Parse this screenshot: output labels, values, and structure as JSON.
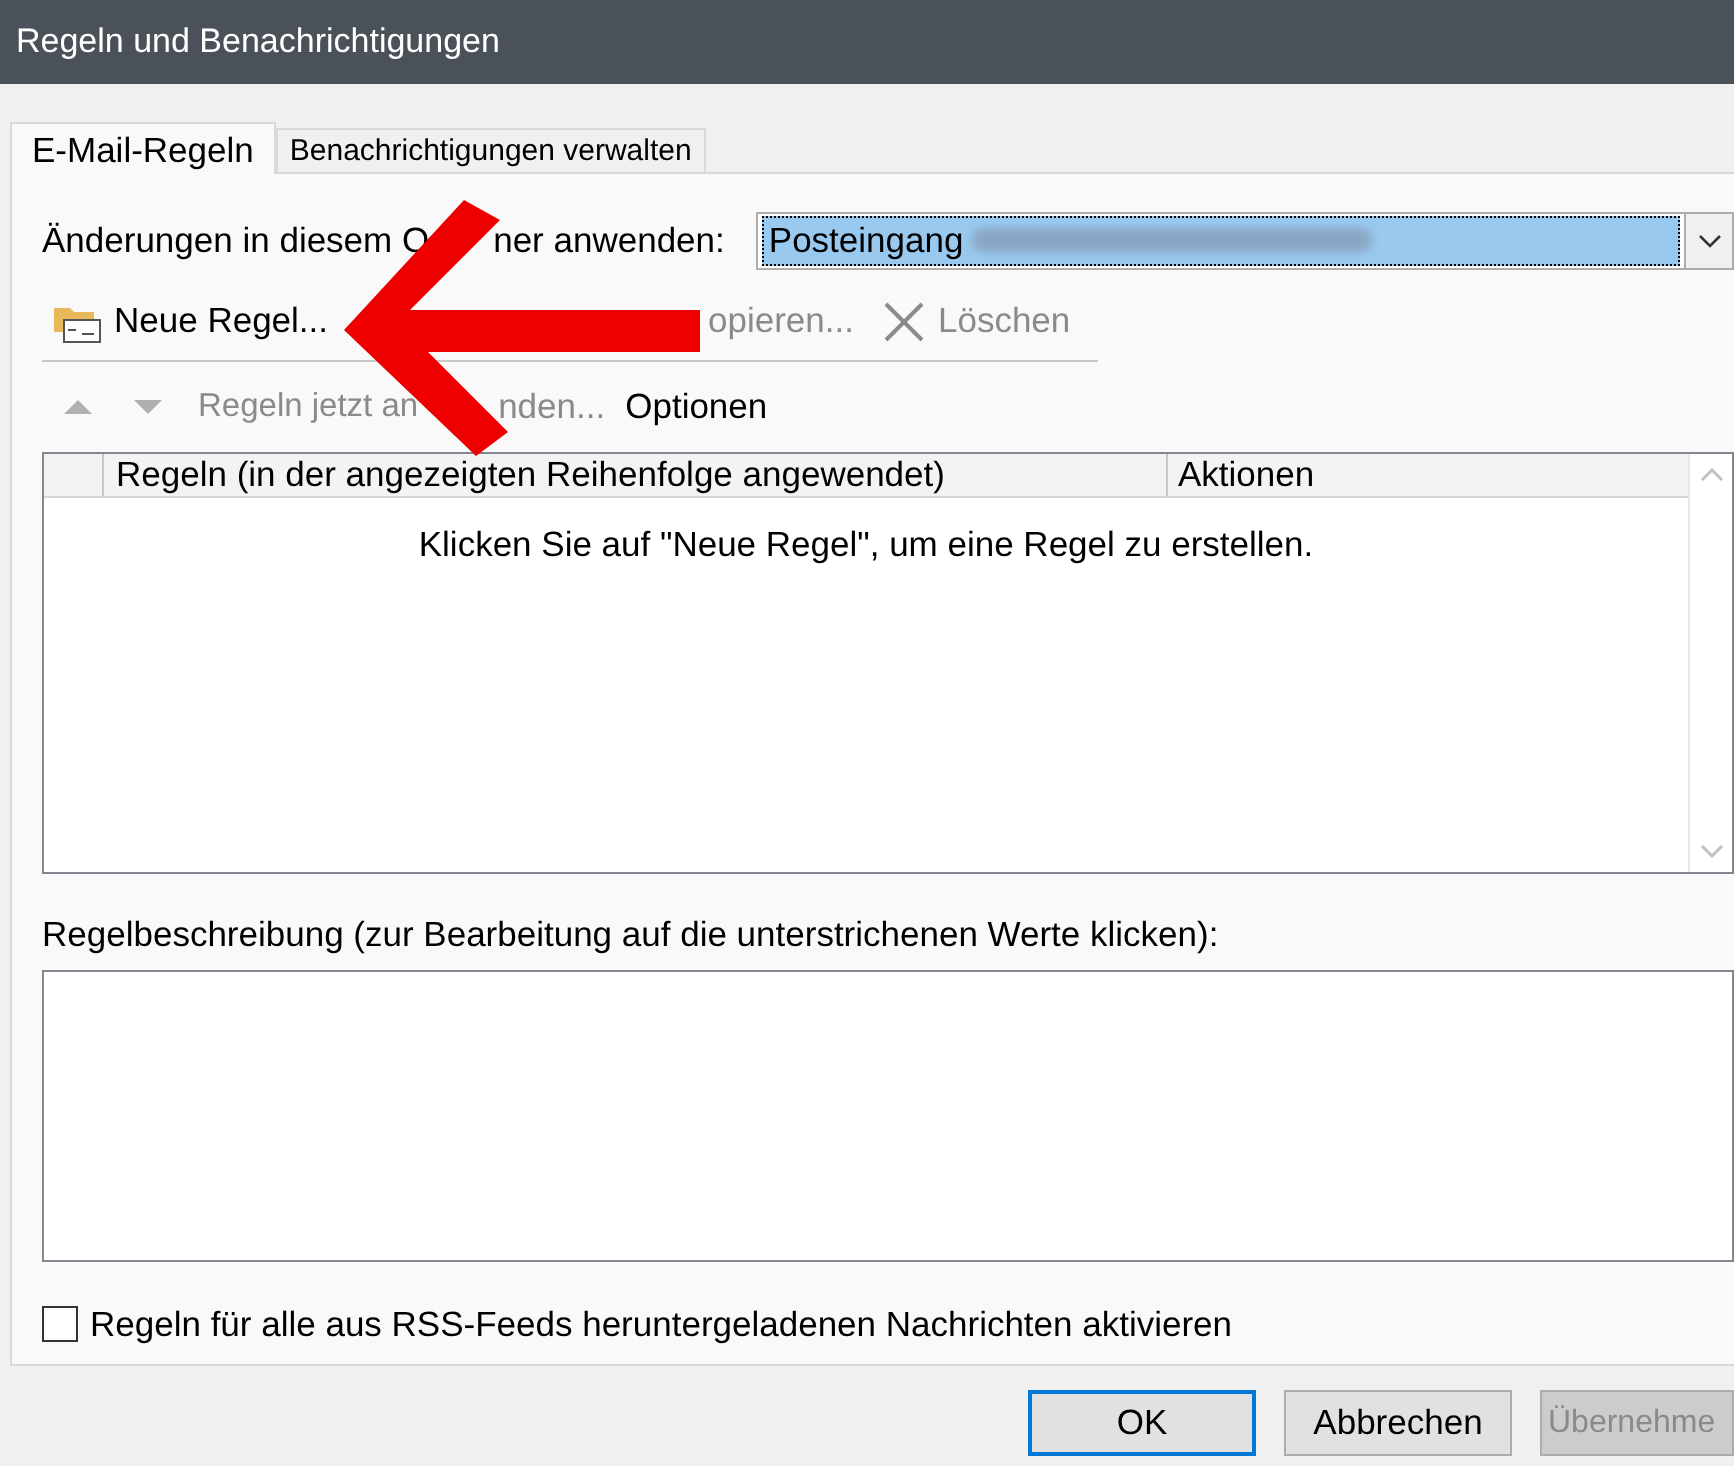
{
  "window": {
    "title": "Regeln und Benachrichtigungen"
  },
  "tabs": [
    {
      "label": "E-Mail-Regeln",
      "selected": true
    },
    {
      "label": "Benachrichtigungen verwalten",
      "selected": false
    }
  ],
  "folder_selector": {
    "label_parts": [
      "Änderungen in diesem O",
      "ner anwenden:"
    ],
    "value": "Posteingang"
  },
  "toolbar": [
    {
      "kind": "new",
      "label": "Neue Regel...",
      "disabled": false
    },
    {
      "kind": "copy",
      "label": "opieren...",
      "disabled": true
    },
    {
      "kind": "delete",
      "label": "Löschen",
      "disabled": true
    }
  ],
  "order_bar": [
    {
      "kind": "up",
      "disabled": true
    },
    {
      "kind": "down",
      "disabled": true
    },
    {
      "kind": "split",
      "label_parts": [
        "Regeln jetzt an",
        "nden..."
      ],
      "disabled": true
    },
    {
      "kind": "text",
      "label": "Optionen",
      "disabled": false
    }
  ],
  "rules_table": {
    "columns": [
      "Regeln (in der angezeigten Reihenfolge angewendet)",
      "Aktionen"
    ],
    "empty_message": "Klicken Sie auf \"Neue Regel\", um eine Regel zu erstellen."
  },
  "description": {
    "label": "Regelbeschreibung (zur Bearbeitung auf die unterstrichenen Werte klicken):"
  },
  "rss_checkbox": {
    "label": "Regeln für alle aus RSS-Feeds heruntergeladenen Nachrichten aktivieren",
    "checked": false
  },
  "buttons": [
    {
      "label": "OK",
      "default": true,
      "disabled": false
    },
    {
      "label": "Abbrechen",
      "default": false,
      "disabled": false
    },
    {
      "label": "Übernehme",
      "default": false,
      "disabled": true
    }
  ]
}
